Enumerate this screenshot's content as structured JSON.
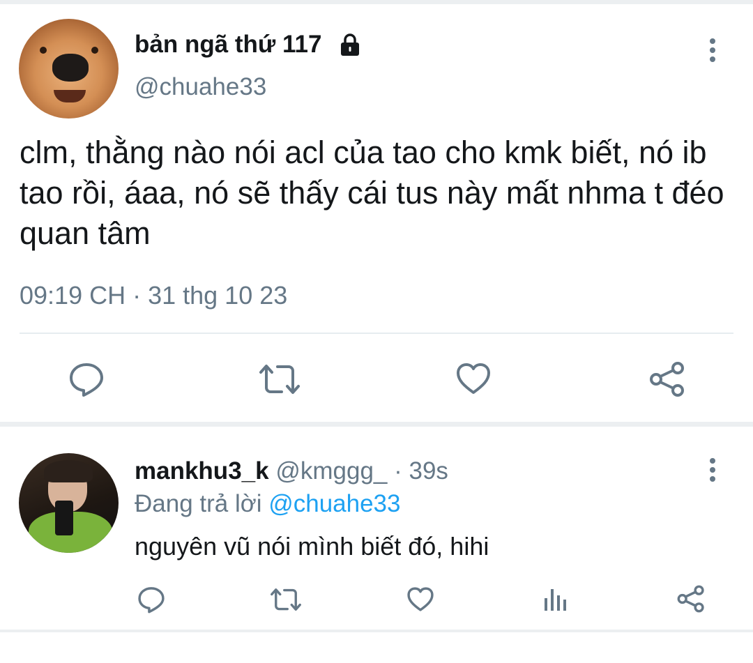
{
  "main_tweet": {
    "author_name": "bản ngã thứ 117",
    "author_handle": "@chuahe33",
    "text": "clm, thằng nào nói acl của tao cho kmk biết, nó ib tao rồi, áaa, nó sẽ thấy cái tus này mất nhma t đéo quan tâm",
    "timestamp": "09:19 CH · 31 thg 10 23",
    "actions": [
      "reply-icon",
      "retweet-icon",
      "like-icon",
      "share-icon"
    ]
  },
  "reply": {
    "author_name": "mankhu3_k",
    "author_handle": "@kmggg_",
    "separator": " · ",
    "time": "39s",
    "replying_prefix": "Đang trả lời ",
    "replying_to": "@chuahe33",
    "text": "nguyên vũ nói mình biết đó, hihi",
    "actions": [
      "reply-icon",
      "retweet-icon",
      "like-icon",
      "analytics-icon",
      "share-icon"
    ]
  },
  "colors": {
    "text": "#14171a",
    "secondary": "#657786",
    "link": "#1da1f2",
    "divider": "#e6ecf0"
  }
}
